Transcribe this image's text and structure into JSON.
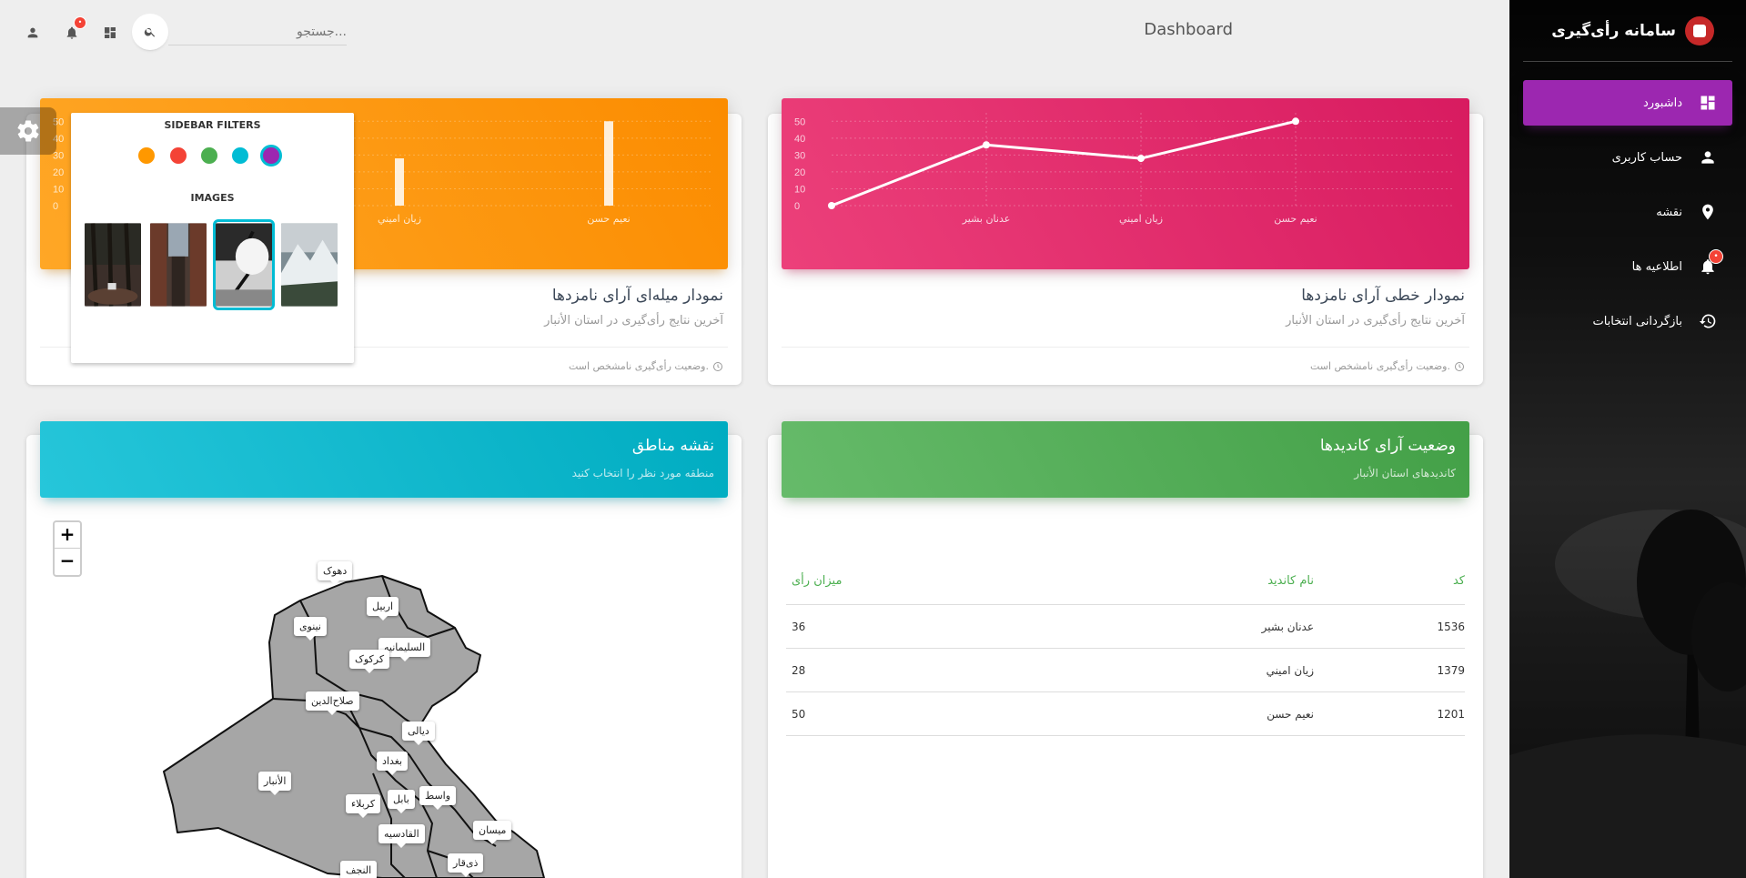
{
  "sidebar": {
    "title": "سامانه رأی‌گیری",
    "items": [
      {
        "label": "داشبورد",
        "icon": "dashboard-icon",
        "active": true
      },
      {
        "label": "حساب کاربری",
        "icon": "person-icon"
      },
      {
        "label": "نقشه",
        "icon": "location-pin-icon"
      },
      {
        "label": "اطلاعیه ها",
        "icon": "bell-icon",
        "badge": "•"
      },
      {
        "label": "بازگردانی انتخابات",
        "icon": "history-icon"
      }
    ],
    "accent": "#9c27b0"
  },
  "topbar": {
    "brand": "Dashboard",
    "search_placeholder": "جستجو...",
    "notif_badge": "•"
  },
  "line_card": {
    "title": "نمودار خطی آرای نامزدها",
    "subtitle": "آخرین نتایج رأی‌گیری در استان الأنبار",
    "footer": "وضعیت رأی‌گیری نامشخص است."
  },
  "bar_card": {
    "title": "نمودار میله‌ای آرای نامزدها",
    "subtitle": "آخرین نتایج رأی‌گیری در استان الأنبار",
    "footer": "وضعیت رأی‌گیری نامشخص است."
  },
  "chart_data": [
    {
      "type": "line",
      "categories": [
        "",
        "عدنان بشير",
        "زيان اميني",
        "نعيم حسن"
      ],
      "values": [
        0,
        36,
        28,
        50
      ],
      "yticks": [
        0,
        10,
        20,
        30,
        40,
        50
      ],
      "ylim": [
        0,
        55
      ],
      "grid": true
    },
    {
      "type": "bar",
      "categories": [
        "زيان اميني",
        "نعيم حسن"
      ],
      "values": [
        28,
        50
      ],
      "yticks": [
        0,
        10,
        20,
        30,
        40,
        50
      ],
      "ylim": [
        0,
        55
      ],
      "grid": true
    }
  ],
  "status_card": {
    "title": "وضعیت آرای کاندیدها",
    "subtitle": "کاندیدهای استان الأنبار",
    "columns": [
      "کد",
      "نام کاندید",
      "میزان رأی"
    ],
    "rows": [
      [
        "1536",
        "عدنان بشير",
        "36"
      ],
      [
        "1379",
        "زيان اميني",
        "28"
      ],
      [
        "1201",
        "نعيم حسن",
        "50"
      ]
    ]
  },
  "map_card": {
    "title": "نقشه مناطق",
    "subtitle": "منطقه مورد نظر را انتخاب کنید",
    "zoom_in": "+",
    "zoom_out": "−",
    "regions": [
      "دهوک",
      "اربیل",
      "نینوی",
      "السلیمانیه",
      "کرکوک",
      "صلاح‌الدین",
      "دیالی",
      "بغداد",
      "الأنبار",
      "کربلاء",
      "بابل",
      "واسط",
      "القادسیه",
      "میسان",
      "النجف",
      "ذی‌قار"
    ]
  },
  "plugin": {
    "filters_title": "SIDEBAR FILTERS",
    "images_title": "IMAGES",
    "colors": [
      "#ff9800",
      "#f44336",
      "#4caf50",
      "#00bcd4",
      "#9c27b0"
    ],
    "active_color": "#9c27b0"
  }
}
